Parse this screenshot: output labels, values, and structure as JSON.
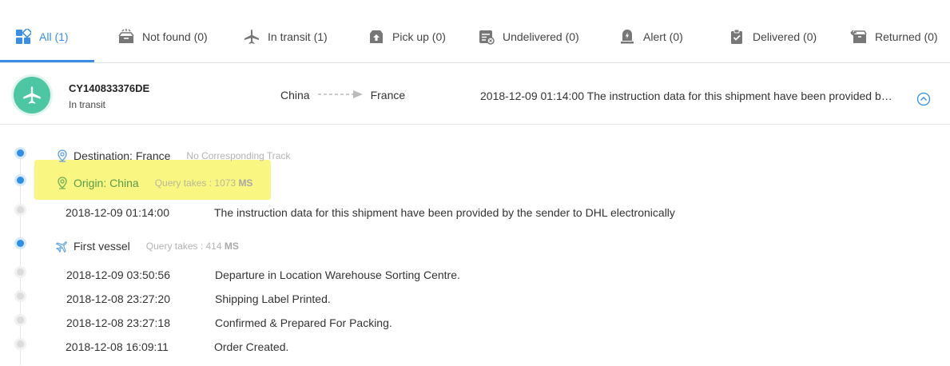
{
  "tabs": [
    {
      "label": "All (1)",
      "icon": "grid-icon",
      "active": true
    },
    {
      "label": "Not found (0)",
      "icon": "empty-box-icon"
    },
    {
      "label": "In transit (1)",
      "icon": "airplane-icon"
    },
    {
      "label": "Pick up (0)",
      "icon": "pickup-box-icon"
    },
    {
      "label": "Undelivered (0)",
      "icon": "undelivered-list-icon"
    },
    {
      "label": "Alert (0)",
      "icon": "alert-icon"
    },
    {
      "label": "Delivered (0)",
      "icon": "clipboard-check-icon"
    },
    {
      "label": "Returned (0)",
      "icon": "return-box-icon"
    }
  ],
  "shipment": {
    "tracking_number": "CY140833376DE",
    "status": "In transit",
    "origin": "China",
    "destination": "France",
    "latest_event": "2018-12-09 01:14:00 The instruction data for this shipment have been provided by the sender to DHL electronically",
    "accent_color": "#4cc6a3"
  },
  "timeline": {
    "destination": {
      "label": "Destination: France",
      "note": "No Corresponding Track"
    },
    "origin": {
      "label": "Origin: China",
      "note_prefix": "Query takes : 1073",
      "note_unit": "MS"
    },
    "origin_events": [
      {
        "time": "2018-12-09 01:14:00",
        "text": "The instruction data for this shipment have been provided by the sender to DHL electronically"
      }
    ],
    "vessel": {
      "label": "First vessel",
      "note_prefix": "Query takes : 414",
      "note_unit": "MS"
    },
    "vessel_events": [
      {
        "time": "2018-12-09 03:50:56",
        "text": "Departure in Location Warehouse Sorting Centre."
      },
      {
        "time": "2018-12-08 23:27:20",
        "text": "Shipping Label Printed."
      },
      {
        "time": "2018-12-08 23:27:18",
        "text": "Confirmed & Prepared For Packing."
      },
      {
        "time": "2018-12-08 16:09:11",
        "text": "Order Created."
      }
    ]
  },
  "colors": {
    "active_tab": "#3a8ee6",
    "timeline_dot": "#2e8fe8",
    "highlight": "#f9f77a"
  }
}
